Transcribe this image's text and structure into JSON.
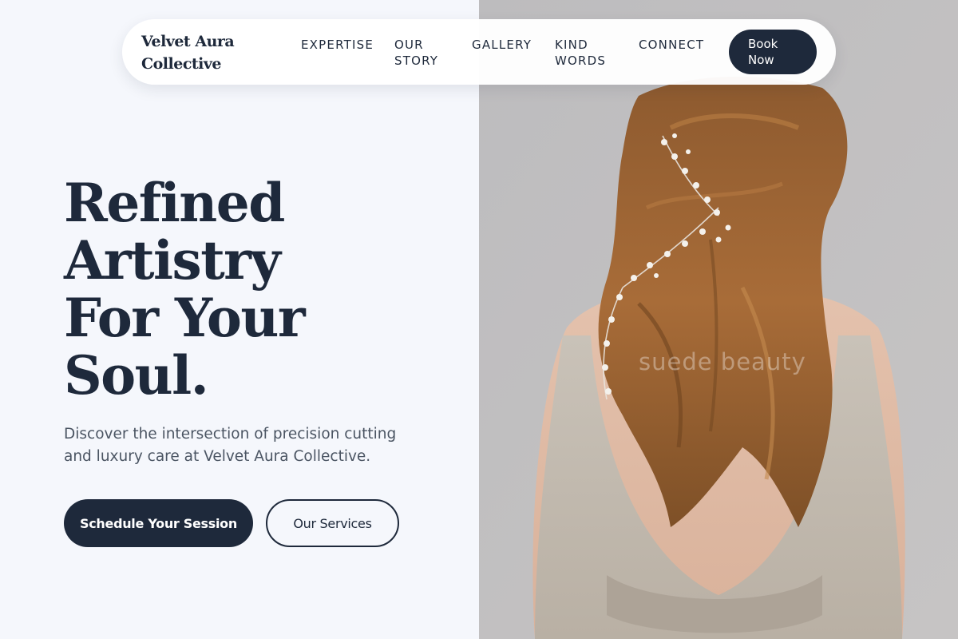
{
  "brand": {
    "name_line1": "Velvet Aura",
    "name_line2": "Collective"
  },
  "nav": {
    "links": [
      {
        "label": "EXPERTISE"
      },
      {
        "label": "OUR STORY"
      },
      {
        "label": "GALLERY"
      },
      {
        "label": "KIND WORDS"
      },
      {
        "label": "CONNECT"
      }
    ],
    "cta_label": "Book Now"
  },
  "hero": {
    "headline_lines": [
      "Refined",
      "Artistry",
      "For Your",
      "Soul."
    ],
    "subtitle": "Discover the intersection of precision cutting and luxury care at Velvet Aura Collective.",
    "primary_button": "Schedule Your Session",
    "secondary_button": "Our Services"
  },
  "image": {
    "description_icon": "bride-hair-photo",
    "watermark": "suede beauty"
  },
  "colors": {
    "navy": "#1e293b",
    "background": "#f5f7fc",
    "text_muted": "#4b5563",
    "white": "#ffffff"
  }
}
